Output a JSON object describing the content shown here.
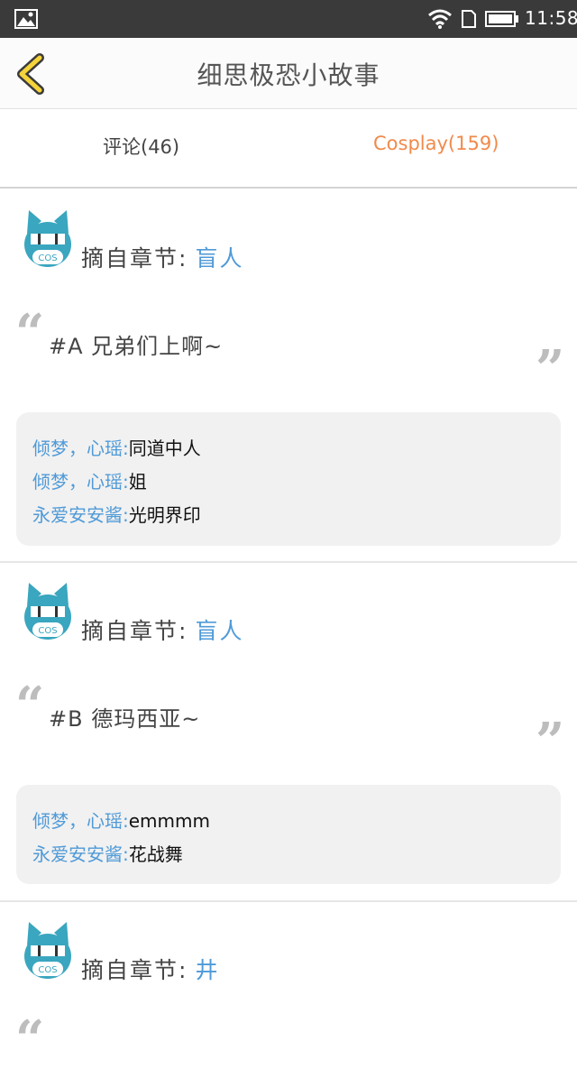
{
  "status_bar": {
    "time": "11:58"
  },
  "header": {
    "title": "细思极恐小故事"
  },
  "tabs": [
    {
      "label": "评论(46)",
      "active": false
    },
    {
      "label": "Cosplay(159)",
      "active": true
    }
  ],
  "colors": {
    "accent": "#f08a4b",
    "link": "#4f9ad8",
    "avatar": "#3aa6bf"
  },
  "avatar_badge": "COS",
  "posts": [
    {
      "chapter_prefix": "摘自章节:",
      "chapter": "盲人",
      "quote": "#A 兄弟们上啊~",
      "replies": [
        {
          "name": "倾梦，心瑶:",
          "text": "同道中人"
        },
        {
          "name": "倾梦，心瑶:",
          "text": "姐"
        },
        {
          "name": "永爱安安酱:",
          "text": "光明界印"
        }
      ]
    },
    {
      "chapter_prefix": "摘自章节:",
      "chapter": "盲人",
      "quote": "#B 德玛西亚~",
      "replies": [
        {
          "name": "倾梦，心瑶:",
          "text": "emmmm"
        },
        {
          "name": "永爱安安酱:",
          "text": "花战舞"
        }
      ]
    },
    {
      "chapter_prefix": "摘自章节:",
      "chapter": "井"
    }
  ]
}
